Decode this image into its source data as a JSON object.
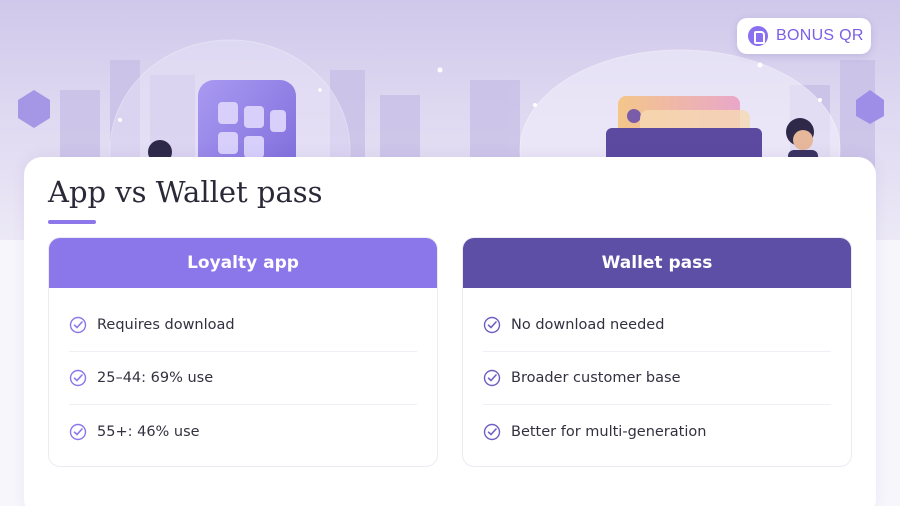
{
  "brand": {
    "label": "BONUS QR",
    "icon": "bonus-qr-logo-icon",
    "accent": "#7b5fe6"
  },
  "page": {
    "title": "App vs Wallet pass",
    "underline_color": "#8b77ea"
  },
  "panels": {
    "loyalty_app": {
      "header": "Loyalty app",
      "header_color": "#8b77ea",
      "items": [
        {
          "text": "Requires download",
          "icon": "check-circle-icon"
        },
        {
          "text": "25–44: 69% use",
          "icon": "check-circle-icon"
        },
        {
          "text": "55+: 46% use",
          "icon": "check-circle-icon"
        }
      ]
    },
    "wallet_pass": {
      "header": "Wallet pass",
      "header_color": "#5d4fa6",
      "items": [
        {
          "text": "No download needed",
          "icon": "check-circle-icon"
        },
        {
          "text": "Broader customer base",
          "icon": "check-circle-icon"
        },
        {
          "text": "Better for multi-generation",
          "icon": "check-circle-icon"
        }
      ]
    }
  }
}
